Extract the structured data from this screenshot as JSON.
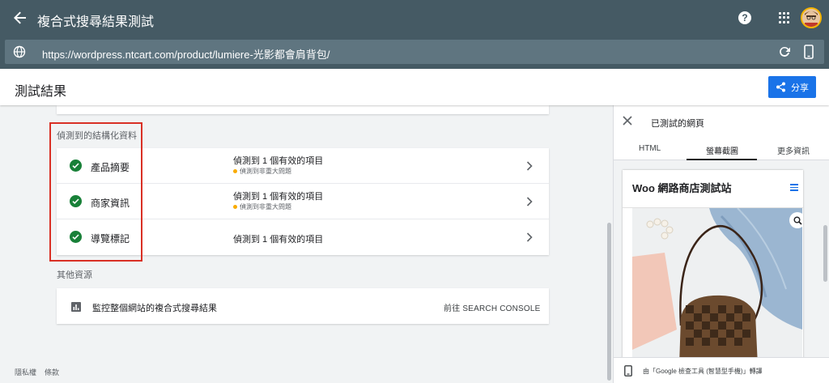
{
  "topbar": {
    "title": "複合式搜尋結果測試",
    "help": "?"
  },
  "urlbar": {
    "url": "https://wordpress.ntcart.com/product/lumiere-光影都會肩背包/"
  },
  "header": {
    "title": "測試結果",
    "share_label": "分享"
  },
  "structured_data": {
    "section_label": "偵測到的結構化資料",
    "items": [
      {
        "name": "產品摘要",
        "status": "偵測到 1 個有效的項目",
        "warning": "偵測到非重大問題"
      },
      {
        "name": "商家資訊",
        "status": "偵測到 1 個有效的項目",
        "warning": "偵測到非重大問題"
      },
      {
        "name": "導覽標記",
        "status": "偵測到 1 個有效的項目",
        "warning": ""
      }
    ]
  },
  "resources": {
    "section_label": "其他資源",
    "monitor_label": "監控整個網站的複合式搜尋結果",
    "link_label": "前往 SEARCH CONSOLE"
  },
  "footer": {
    "privacy": "隱私權",
    "terms": "條款"
  },
  "right_panel": {
    "title": "已測試的網頁",
    "tabs": [
      "HTML",
      "螢幕截圖",
      "更多資訊"
    ],
    "active_tab": 1,
    "site_title": "Woo 網路商店測試站",
    "footer_text": "由「Google 檢查工具 (智慧型手機)」轉譯"
  },
  "colors": {
    "topbar": "#455a64",
    "accent": "#1a73e8",
    "success": "#188038",
    "warning": "#f9ab00",
    "highlight_box": "#d93025"
  }
}
